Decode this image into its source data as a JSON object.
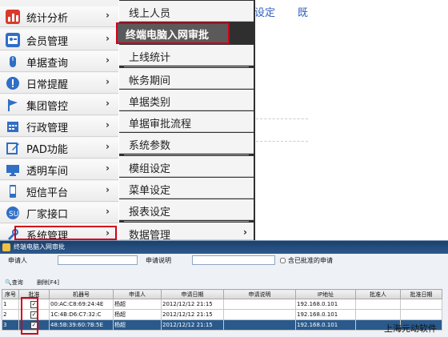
{
  "left_menu": {
    "items": [
      {
        "label": "统计分析",
        "icon": "bar-chart-icon",
        "color": "#d93a2b"
      },
      {
        "label": "会员管理",
        "icon": "member-card-icon",
        "color": "#2f6fc6"
      },
      {
        "label": "单据查询",
        "icon": "mouse-icon",
        "color": "#2f6fc6"
      },
      {
        "label": "日常提醒",
        "icon": "alert-icon",
        "color": "#2f6fc6"
      },
      {
        "label": "集团管控",
        "icon": "flag-icon",
        "color": "#2f6fc6"
      },
      {
        "label": "行政管理",
        "icon": "calendar-icon",
        "color": "#2f6fc6"
      },
      {
        "label": "PAD功能",
        "icon": "edit-icon",
        "color": "#2f6fc6"
      },
      {
        "label": "透明车间",
        "icon": "monitor-icon",
        "color": "#2f6fc6"
      },
      {
        "label": "短信平台",
        "icon": "phone-icon",
        "color": "#2f6fc6"
      },
      {
        "label": "厂家接口",
        "icon": "stumble-icon",
        "color": "#2f6fc6"
      },
      {
        "label": "系统管理",
        "icon": "settings-icon",
        "color": "#2f6fc6"
      }
    ]
  },
  "submenu": {
    "items": [
      {
        "label": "线上人员"
      },
      {
        "label": "终端电脑入网审批"
      },
      {
        "label": "上线统计"
      },
      {
        "label": "帐务期间"
      },
      {
        "label": "单据类别"
      },
      {
        "label": "单据审批流程"
      },
      {
        "label": "系统参数"
      },
      {
        "label": "模组设定"
      },
      {
        "label": "菜单设定"
      },
      {
        "label": "报表设定"
      },
      {
        "label": "数据管理"
      }
    ]
  },
  "background": {
    "text_1": "设定",
    "text_2": "既"
  },
  "dialog": {
    "title": "终端电脑入网审批",
    "applicant_label": "申请人",
    "applicant_value": "",
    "note_label": "申请说明",
    "note_value": "",
    "include_approved_label": "含已批准的申请",
    "query_label": "查询",
    "delete_label": "删除[F4]",
    "columns": [
      "序号",
      "批准",
      "机器号",
      "申请人",
      "申请日期",
      "申请说明",
      "IP地址",
      "批准人",
      "批准日期"
    ],
    "rows": [
      {
        "no": "1",
        "approved": "✓",
        "machine": "00:AC:C8:69:24:4E",
        "applicant": "杨超",
        "date": "2012/12/12 21:15",
        "note": "",
        "ip": "192.168.0.101",
        "approver": "",
        "approve_date": ""
      },
      {
        "no": "2",
        "approved": "✓",
        "machine": "1C:4B:D6:C7:32:C",
        "applicant": "杨超",
        "date": "2012/12/12 21:15",
        "note": "",
        "ip": "192.168.0.101",
        "approver": "",
        "approve_date": ""
      },
      {
        "no": "3",
        "approved": "✓",
        "machine": "48:5B:39:60:7B:5E",
        "applicant": "杨超",
        "date": "2012/12/12 21:15",
        "note": "",
        "ip": "192.168.0.101",
        "approver": "",
        "approve_date": ""
      }
    ]
  },
  "watermark": "上海元动软件",
  "colors": {
    "highlight_border": "#d0021b",
    "title_bar": "#1d3f6b",
    "selected_row": "#2a5a8c"
  }
}
